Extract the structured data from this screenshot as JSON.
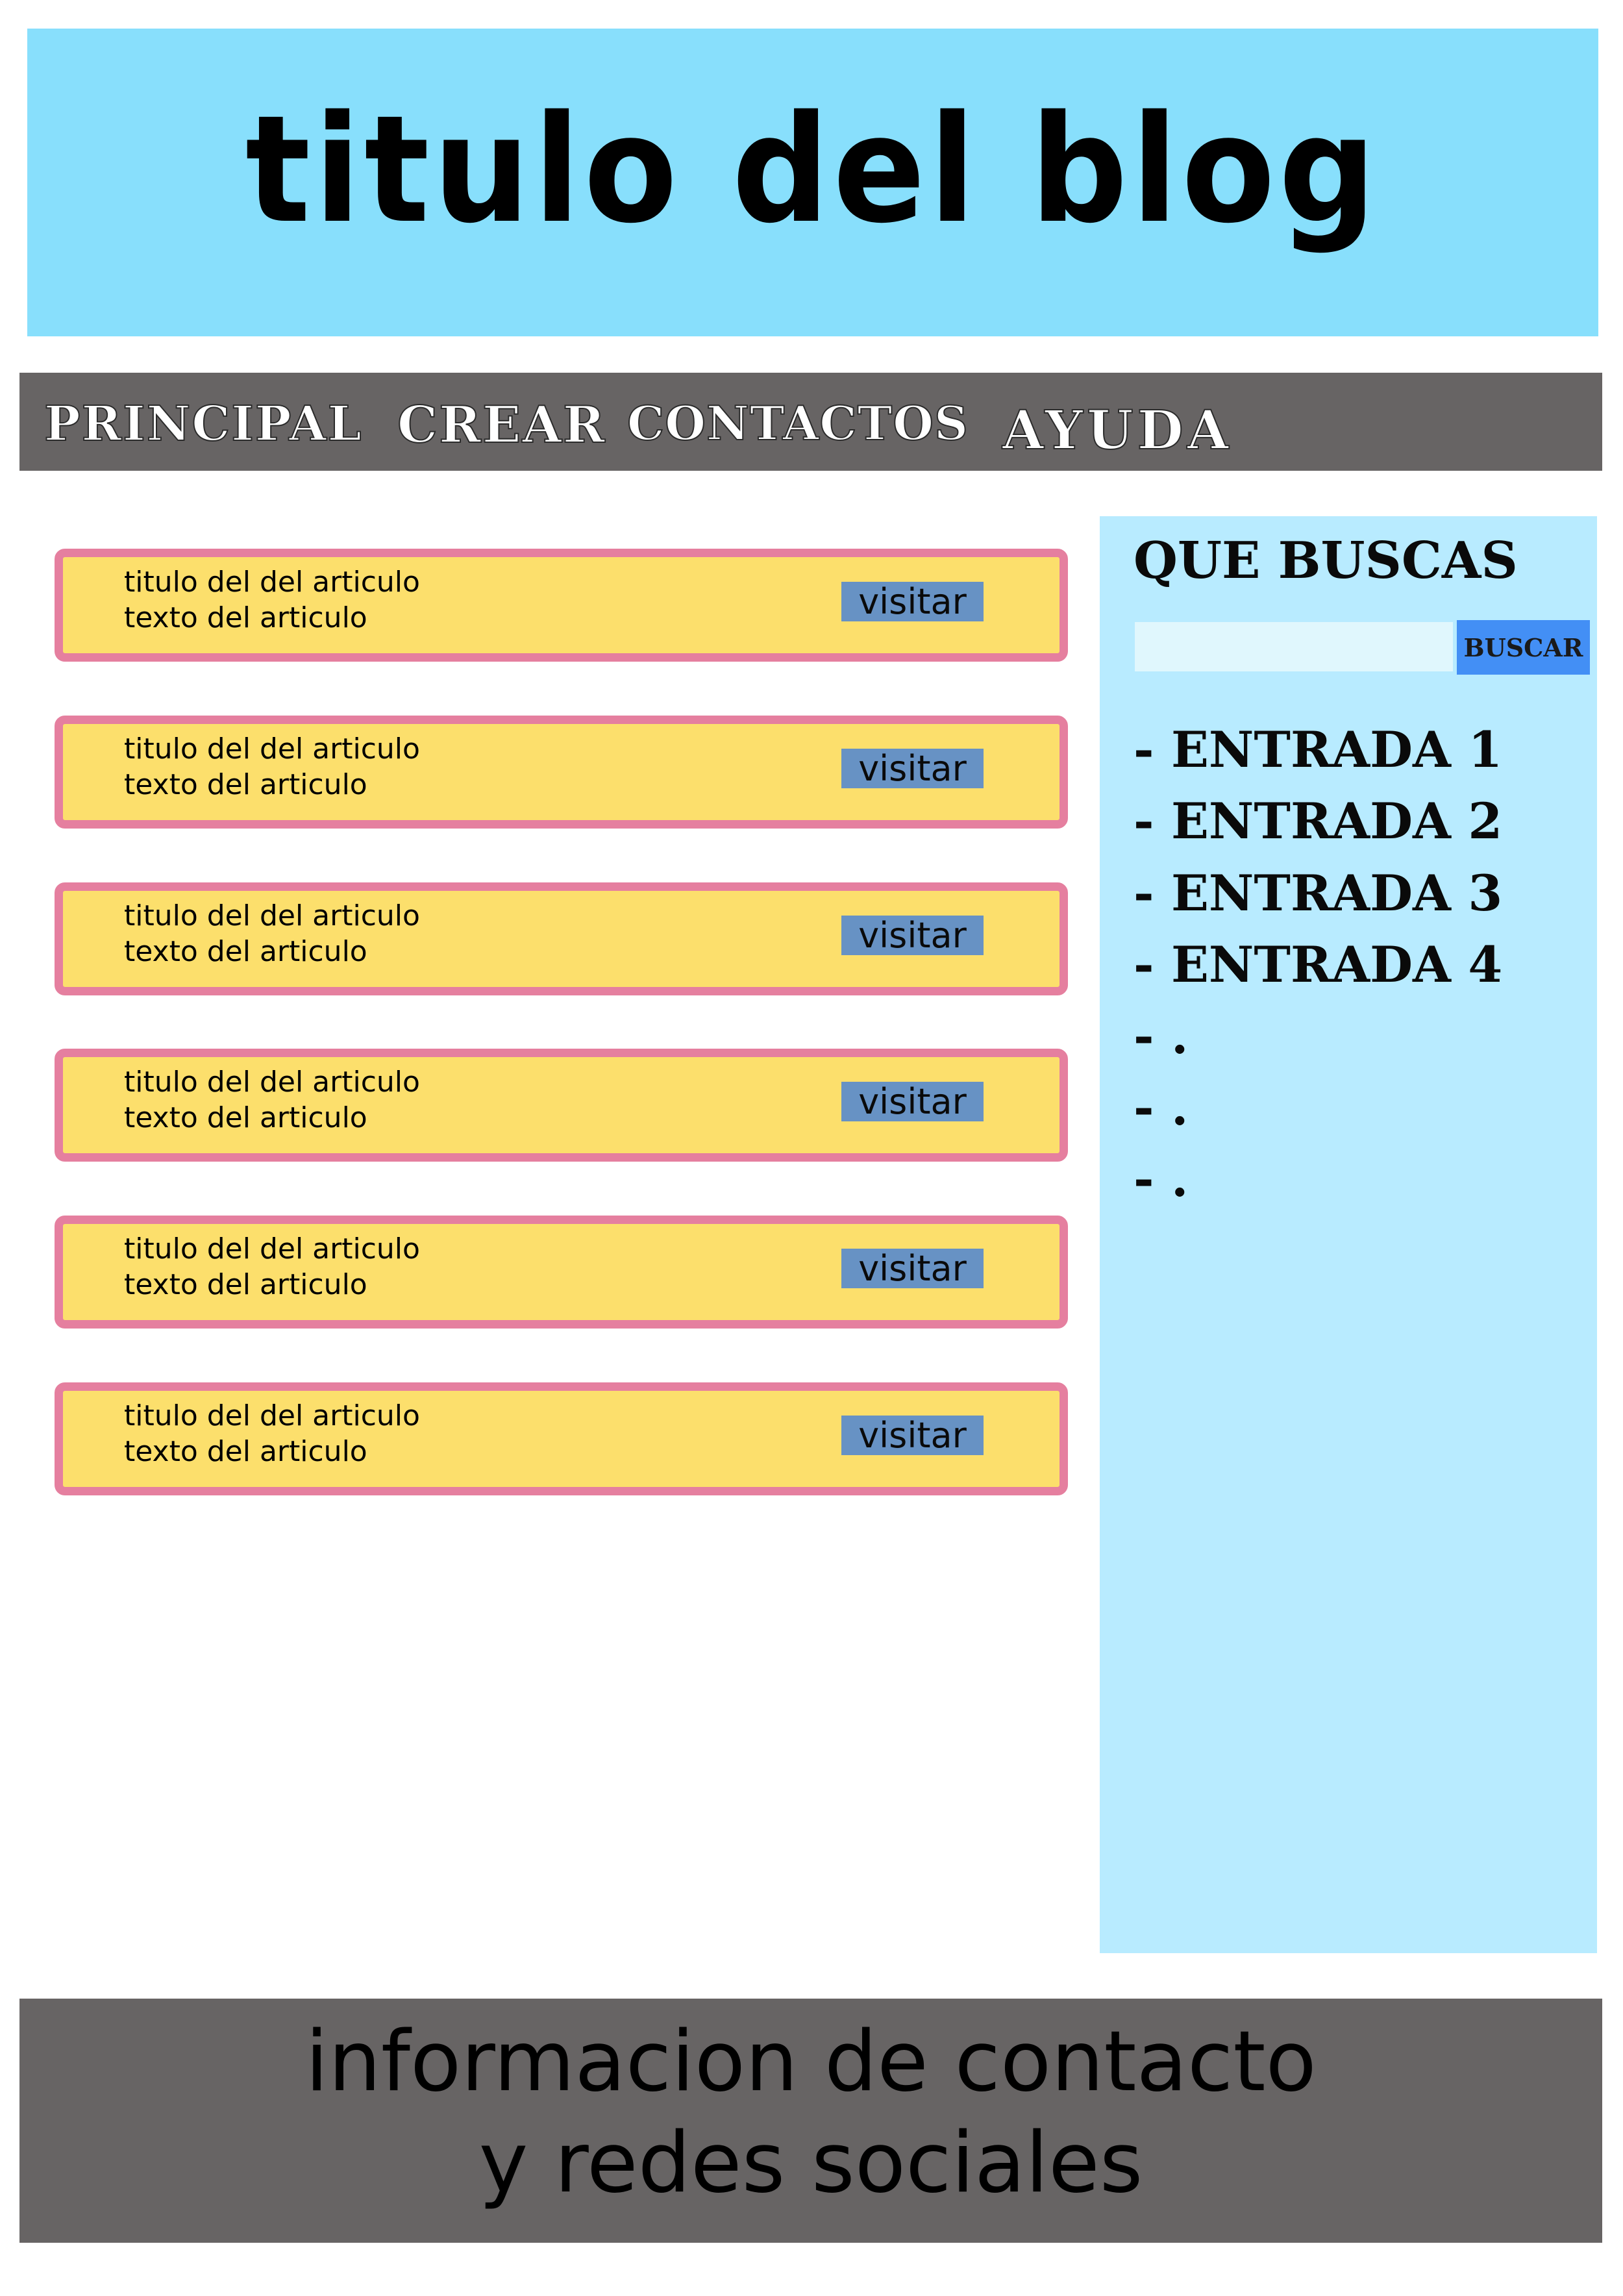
{
  "header": {
    "title": "titulo del blog"
  },
  "nav": {
    "items": [
      {
        "label": "PRINCIPAL"
      },
      {
        "label": "CREAR"
      },
      {
        "label": "CONTACTOS"
      },
      {
        "label": "AYUDA"
      }
    ]
  },
  "articles": [
    {
      "title": "titulo del del articulo",
      "text": "texto del articulo",
      "button": "visitar"
    },
    {
      "title": "titulo del del articulo",
      "text": "texto del articulo",
      "button": "visitar"
    },
    {
      "title": "titulo del del articulo",
      "text": "texto del articulo",
      "button": "visitar"
    },
    {
      "title": "titulo del del articulo",
      "text": "texto del articulo",
      "button": "visitar"
    },
    {
      "title": "titulo del del articulo",
      "text": "texto del articulo",
      "button": "visitar"
    },
    {
      "title": "titulo del del articulo",
      "text": "texto del articulo",
      "button": "visitar"
    }
  ],
  "sidebar": {
    "heading": "QUE BUSCAS",
    "search": {
      "value": "",
      "button": "BUSCAR"
    },
    "entries": [
      "- ENTRADA 1",
      "- ENTRADA 2",
      "- ENTRADA 3",
      "- ENTRADA 4",
      "- .",
      "- .",
      "- ."
    ]
  },
  "footer": {
    "line1": "informacion de contacto",
    "line2": "y redes sociales"
  },
  "colors": {
    "header_bg": "#88dffc",
    "nav_bg": "#676464",
    "article_bg": "#fcdf6c",
    "article_border": "#e57f9f",
    "visit_button": "#6792c4",
    "sidebar_bg": "#b8ebff",
    "search_input_bg": "#e0f7fd",
    "search_button": "#438ff5",
    "footer_bg": "#676464"
  }
}
